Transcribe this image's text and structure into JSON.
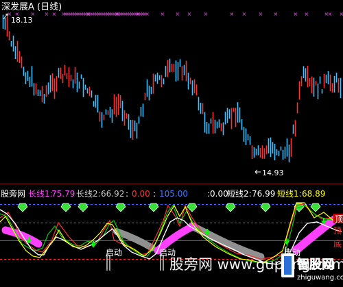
{
  "main_panel": {
    "title": "深发展A (日线)",
    "high_label": "18.13",
    "low_label": "14.93"
  },
  "indicator_panel": {
    "name": "股旁网",
    "values": [
      {
        "label": "长线1:",
        "value": "75.79",
        "color": "#ff40ff"
      },
      {
        "label": "长线2:",
        "value": "66.92",
        "color": "#c8c8c8"
      },
      {
        "label": "",
        "value": "0.00",
        "color": "#ff3030"
      },
      {
        "label": "",
        "value": "105.00",
        "color": "#3a7bff"
      },
      {
        "label": "",
        "value": "0.00",
        "color": "#ffffff"
      },
      {
        "label": "短线2:",
        "value": "76.99",
        "color": "#ffffff"
      },
      {
        "label": "短线1:",
        "value": "68.89",
        "color": "#ffff00"
      }
    ],
    "markers": [
      "启动",
      "启动",
      "启动"
    ],
    "side_labels": [
      "顶",
      "顶",
      "底"
    ]
  },
  "watermark": {
    "text": "股旁网 www.gupang.com",
    "logo_text": "智股网",
    "logo_sub": "zhiguwang.com"
  },
  "colors": {
    "up": "#ff3030",
    "down": "#40c0ff",
    "short1": "#ffff00",
    "short2": "#ffffff",
    "long1": "#ff40ff",
    "long2": "#b4b4b4",
    "green_line": "#00d000",
    "top_marker": "#ff40ff",
    "arrow": "#00ff00",
    "dashed_blue": "#3a6bff",
    "dashed_red": "#ff3030"
  }
}
